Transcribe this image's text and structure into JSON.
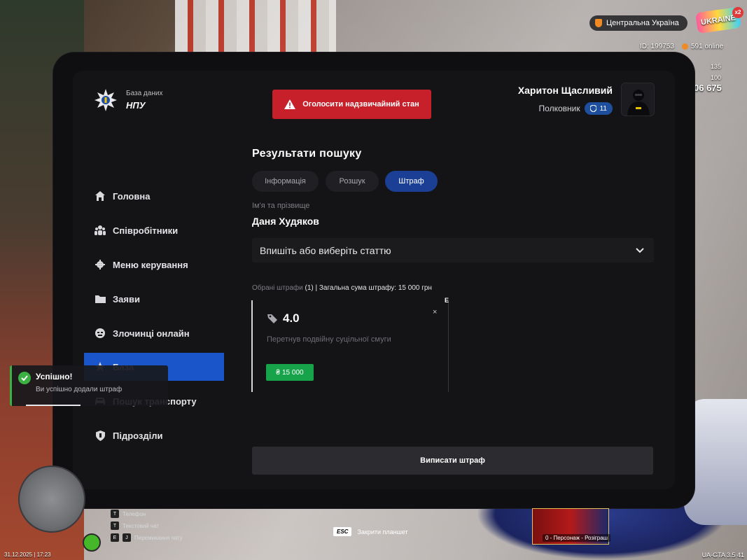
{
  "hud": {
    "region": "Центральна Україна",
    "logo_text": "UKRAINE",
    "multiplier": "x2",
    "player_id": "ID: 199753",
    "online": "591 online",
    "stat_health": "135",
    "stat_armor": "100",
    "money": "06 675"
  },
  "tablet": {
    "brand_small": "База даних",
    "brand_big": "НПУ",
    "emergency_label": "Оголосити надзвичайний стан",
    "user_name": "Харитон Щасливий",
    "user_rank": "Полковник",
    "rank_level": "11"
  },
  "sidebar": {
    "items": [
      {
        "label": "Головна",
        "icon": "home-icon"
      },
      {
        "label": "Співробітники",
        "icon": "users-icon"
      },
      {
        "label": "Меню керування",
        "icon": "gear-icon"
      },
      {
        "label": "Заяви",
        "icon": "folder-icon"
      },
      {
        "label": "Злочинці онлайн",
        "icon": "criminal-icon"
      },
      {
        "label": "База",
        "icon": "star-icon",
        "active": true
      },
      {
        "label": "Пошук транспорту",
        "icon": "car-icon"
      },
      {
        "label": "Підрозділи",
        "icon": "shield-icon"
      }
    ]
  },
  "main": {
    "title": "Результати пошуку",
    "tabs": [
      {
        "label": "Інформація"
      },
      {
        "label": "Розшук"
      },
      {
        "label": "Штраф",
        "active": true
      }
    ],
    "name_label": "Ім'я та прізвище",
    "person_name": "Даня Худяков",
    "select_placeholder": "Впишіть або виберіть статтю",
    "summary_prefix": "Обрані штрафи",
    "summary_count": "(1) | Загальна сума штрафу: 15 000 грн",
    "fine": {
      "code": "4.0",
      "description": "Перетнув подвійну суцільної смуги",
      "amount": "15 000",
      "edge_letter": "Е",
      "close": "×"
    },
    "submit_label": "Виписати штраф"
  },
  "toast": {
    "title": "Успішно!",
    "text": "Ви успішно додали штраф"
  },
  "footer": {
    "esc_key": "ESC",
    "esc_label": "Закрити планшет",
    "key1": "Т",
    "key1_label": "Телефон",
    "key2": "Т",
    "key2_label": "Текстовий чат",
    "key3": "Е",
    "key4": "J",
    "key34_label": "Перемикання чату",
    "datetime": "31.12.2025 | 17:23",
    "promo_label": "0 - Персонаж - Розіграш",
    "version": "UA-GTA 3.5",
    "version_extra": "41"
  },
  "colors": {
    "accent_blue": "#1a56c9",
    "emergency_red": "#c8202b",
    "success_green": "#3bb143",
    "amount_green": "#17a34a"
  }
}
